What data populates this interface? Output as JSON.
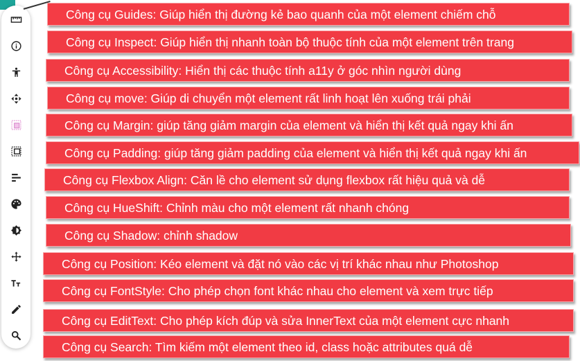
{
  "accent_color": "#f13b44",
  "tools": [
    {
      "icon": "ruler-icon",
      "label": "Công cụ Guides: Giúp hiển thị đường kẻ bao quanh của một element chiếm chỗ"
    },
    {
      "icon": "info-icon",
      "label": "Công cụ Inspect: Giúp hiển thị nhanh toàn bộ thuộc tính của một element trên trang"
    },
    {
      "icon": "accessibility-icon",
      "label": "Công cụ Accessibility: Hiển thị các thuộc tính a11y ở góc nhìn người dùng"
    },
    {
      "icon": "move-icon",
      "label": "Công cụ move: Giúp di chuyển một element rất linh hoạt lên xuống trái phải"
    },
    {
      "icon": "margin-icon",
      "label": "Công cụ Margin: giúp tăng giảm margin của element và hiển thị kết quả ngay khi ấn"
    },
    {
      "icon": "padding-icon",
      "label": "Công cụ Padding: giúp tăng giảm padding của element và hiển thị kết quả ngay khi ấn"
    },
    {
      "icon": "align-icon",
      "label": "Công cụ Flexbox Align: Căn lề cho element sử dụng flexbox rất hiệu quả và dễ"
    },
    {
      "icon": "palette-icon",
      "label": "Công cụ HueShift: Chỉnh màu cho một element rất nhanh chóng"
    },
    {
      "icon": "shadow-icon",
      "label": "Công cụ Shadow: chỉnh shadow"
    },
    {
      "icon": "position-icon",
      "label": "Công cụ Position: Kéo element và đặt nó vào các vị trí khác nhau như Photoshop"
    },
    {
      "icon": "font-size-icon",
      "label": "Công cụ FontStyle: Cho phép chọn font khác nhau cho element và xem trực tiếp"
    },
    {
      "icon": "pencil-icon",
      "label": "Công cụ EditText: Cho phép kích đúp và sửa InnerText của một element cực nhanh"
    },
    {
      "icon": "search-icon",
      "label": "Công cụ Search: Tìm kiếm một element theo id, class hoặc attributes quá dễ"
    }
  ]
}
